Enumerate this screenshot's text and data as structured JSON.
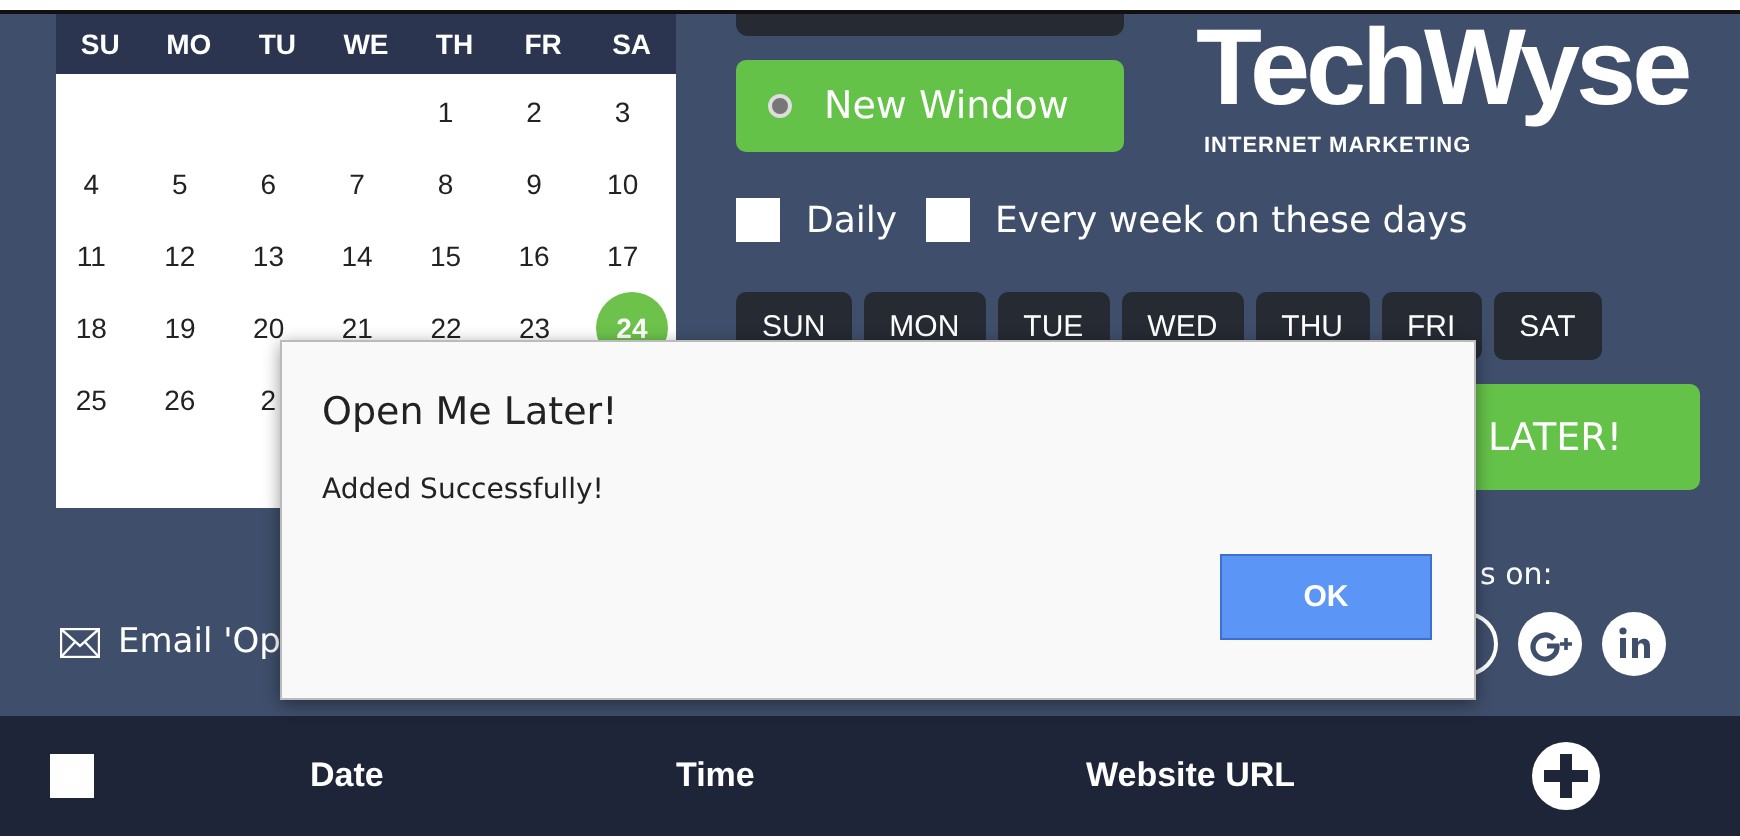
{
  "calendar": {
    "weekdays": [
      "SU",
      "MO",
      "TU",
      "WE",
      "TH",
      "FR",
      "SA"
    ],
    "weeks": [
      [
        {
          "label": "1",
          "selected": false
        },
        {
          "label": "2",
          "selected": false
        },
        {
          "label": "3",
          "selected": false
        }
      ],
      [
        {
          "label": "4",
          "selected": false
        },
        {
          "label": "5",
          "selected": false
        },
        {
          "label": "6",
          "selected": false
        },
        {
          "label": "7",
          "selected": false
        },
        {
          "label": "8",
          "selected": false
        },
        {
          "label": "9",
          "selected": false
        },
        {
          "label": "10",
          "selected": false
        }
      ],
      [
        {
          "label": "11",
          "selected": false
        },
        {
          "label": "12",
          "selected": false
        },
        {
          "label": "13",
          "selected": false
        },
        {
          "label": "14",
          "selected": false
        },
        {
          "label": "15",
          "selected": false
        },
        {
          "label": "16",
          "selected": false
        },
        {
          "label": "17",
          "selected": false
        }
      ],
      [
        {
          "label": "18",
          "selected": false
        },
        {
          "label": "19",
          "selected": false
        },
        {
          "label": "20",
          "selected": false
        },
        {
          "label": "21",
          "selected": false
        },
        {
          "label": "22",
          "selected": false
        },
        {
          "label": "23",
          "selected": false
        },
        {
          "label": "24",
          "selected": true
        }
      ],
      [
        {
          "label": "25",
          "selected": false
        },
        {
          "label": "26",
          "selected": false
        },
        {
          "label": "2",
          "selected": false
        }
      ]
    ]
  },
  "open_mode": {
    "label": "New Window",
    "selected": true
  },
  "logo": {
    "name": "TechWyse",
    "tagline": "INTERNET MARKETING"
  },
  "repeat_options": [
    {
      "label": "Daily",
      "checked": false
    },
    {
      "label": "Every week on these days",
      "checked": false
    }
  ],
  "weekday_buttons": [
    {
      "label": "SUN",
      "selected": false
    },
    {
      "label": "MON",
      "selected": false
    },
    {
      "label": "TUE",
      "selected": false
    },
    {
      "label": "WED",
      "selected": false
    },
    {
      "label": "THU",
      "selected": false
    },
    {
      "label": "FRI",
      "selected": false
    },
    {
      "label": "SAT",
      "selected": false
    }
  ],
  "submit_button": "LATER!",
  "share": {
    "label": "s on:"
  },
  "email_link": "Email 'Op",
  "table": {
    "select_all_checked": false,
    "columns": [
      "Date",
      "Time",
      "Website URL"
    ]
  },
  "dialog": {
    "title": "Open Me Later!",
    "message": "Added Successfully!",
    "button": "OK"
  }
}
